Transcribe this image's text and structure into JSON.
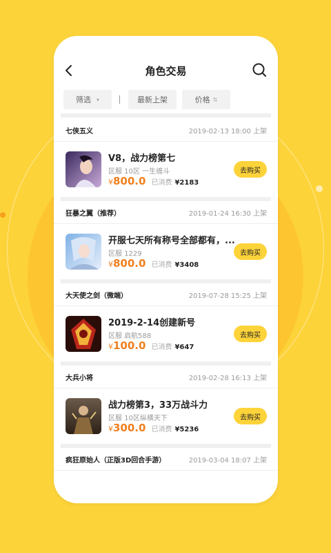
{
  "header": {
    "title": "角色交易"
  },
  "filters": {
    "filter_label": "筛选",
    "latest_label": "最新上架",
    "price_label": "价格",
    "caret_down": "▾",
    "sort_caret": "⇅"
  },
  "listings": [
    {
      "game": "七侠五义",
      "time": "2019-02-13 18:00 上架",
      "title": "V8，战力榜第七",
      "server": "区服 10区 一生缠斗",
      "currency": "¥",
      "price": "800.0",
      "spent_label": "已消费",
      "spent": "¥2183",
      "buy_label": "去购买"
    },
    {
      "game": "狂暴之翼（推荐）",
      "time": "2019-01-24 16:30 上架",
      "title": "开服七天所有称号全部都有，...",
      "server": "区服 1229",
      "currency": "¥",
      "price": "800.0",
      "spent_label": "已消费",
      "spent": "¥3408",
      "buy_label": "去购买"
    },
    {
      "game": "大天使之剑（微端）",
      "time": "2019-07-28 15:25 上架",
      "title": "2019-2-14创建新号",
      "server": "区服 启航588",
      "currency": "¥",
      "price": "100.0",
      "spent_label": "已消费",
      "spent": "¥647",
      "buy_label": "去购买"
    },
    {
      "game": "大兵小将",
      "time": "2019-02-28 16:13 上架",
      "title": "战力榜第3，33万战斗力",
      "server": "区服 10区纵横天下",
      "currency": "¥",
      "price": "300.0",
      "spent_label": "已消费",
      "spent": "¥5236",
      "buy_label": "去购买"
    },
    {
      "game": "疯狂原始人（正版3D回合手游）",
      "time": "2019-03-04 18:07 上架"
    }
  ],
  "colors": {
    "accent": "#FDD33A",
    "price": "#F07F1E"
  },
  "icons": {
    "back": "back-arrow-icon",
    "search": "search-icon"
  }
}
